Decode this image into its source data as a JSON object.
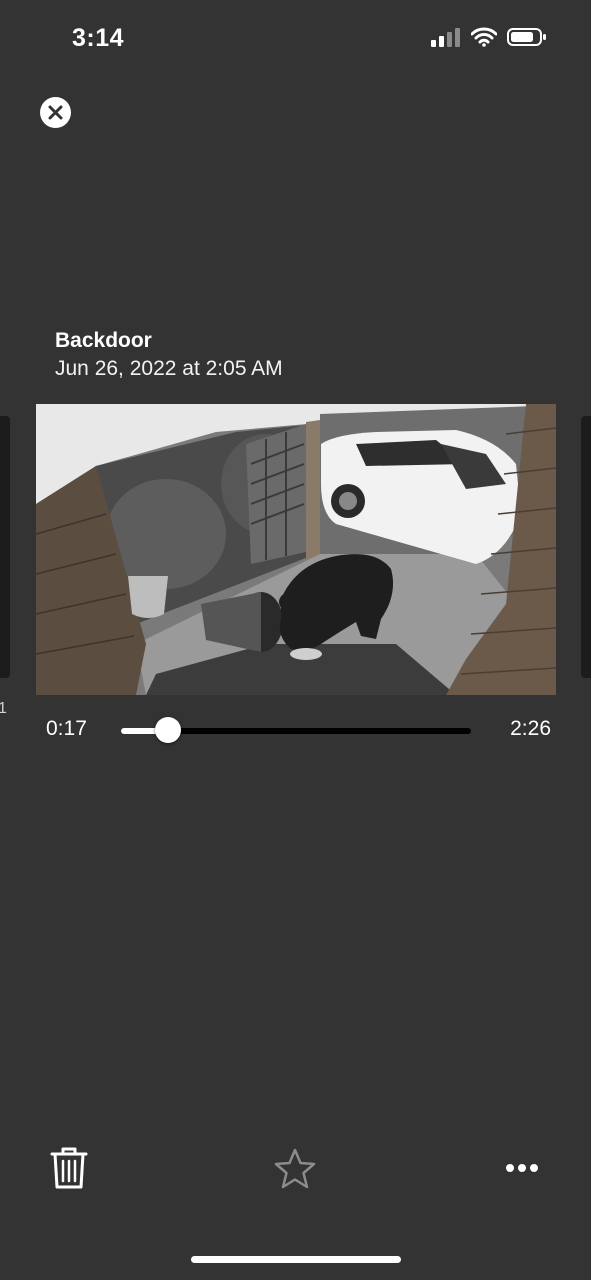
{
  "status_bar": {
    "time": "3:14",
    "icons": [
      "cellular-signal-icon",
      "wifi-icon",
      "battery-icon"
    ]
  },
  "event": {
    "camera_name": "Backdoor",
    "datetime": "Jun 26, 2022 at 2:05 AM"
  },
  "side_preview": {
    "left_label": "1"
  },
  "player": {
    "current_time": "0:17",
    "total_time": "2:26",
    "progress": 0.134
  },
  "toolbar": {
    "icons": [
      "close-icon",
      "trash-icon",
      "star-icon",
      "more-icon"
    ]
  },
  "colors": {
    "background": "#333333",
    "track": "#000000",
    "accent": "#ffffff"
  }
}
